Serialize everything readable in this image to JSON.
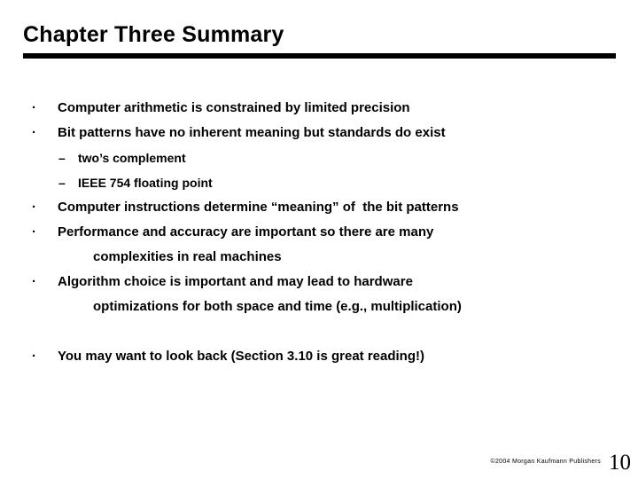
{
  "slide": {
    "title": "Chapter Three Summary",
    "rule_color": "#000000",
    "background_color": "#ffffff",
    "text_color": "#000000"
  },
  "markers": {
    "bullet": "·",
    "dash": "–"
  },
  "body": {
    "lines": [
      {
        "level": 1,
        "text": "Computer arithmetic is constrained by limited precision"
      },
      {
        "level": 1,
        "text": "Bit patterns have no inherent meaning but standards do exist"
      },
      {
        "level": 2,
        "text": "two’s complement"
      },
      {
        "level": 2,
        "text": "IEEE 754 floating point"
      },
      {
        "level": 1,
        "text": "Computer instructions determine “meaning” of  the bit patterns"
      },
      {
        "level": 1,
        "text": "Performance and accuracy are important so there are many"
      },
      {
        "level": 0,
        "text": "complexities in real machines"
      },
      {
        "level": 1,
        "text": "Algorithm choice is important and may lead to hardware"
      },
      {
        "level": 0,
        "text": "optimizations for both space and time (e.g., multiplication)"
      },
      {
        "level": -1,
        "text": ""
      },
      {
        "level": 1,
        "text": "You may want to look back (Section 3.10 is great reading!)"
      }
    ]
  },
  "footer": {
    "copyright": "©2004 Morgan Kaufmann Publishers",
    "slide_number": "10"
  }
}
